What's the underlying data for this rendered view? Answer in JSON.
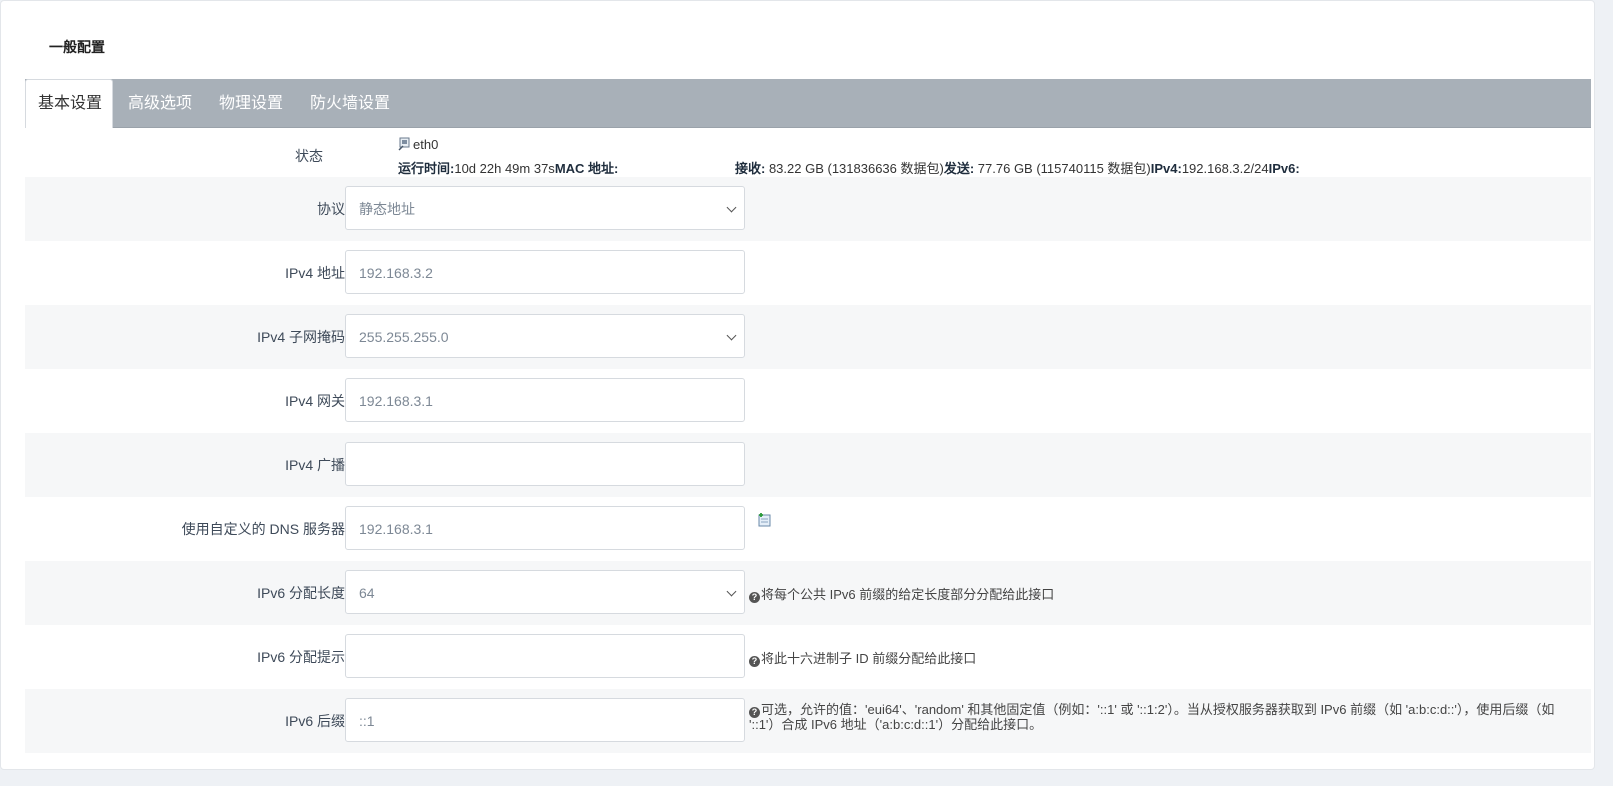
{
  "section_title": "一般配置",
  "tabs": [
    {
      "label": "基本设置",
      "active": true
    },
    {
      "label": "高级选项",
      "active": false
    },
    {
      "label": "物理设置",
      "active": false
    },
    {
      "label": "防火墙设置",
      "active": false
    }
  ],
  "status": {
    "label": "状态",
    "interface": "eth0",
    "uptime_label": "运行时间:",
    "uptime_value": "10d 22h 49m 37s",
    "mac_label": "MAC 地址:",
    "rx_label": "接收:",
    "rx_value": " 83.22 GB (131836636 数据包)",
    "tx_label": "发送:",
    "tx_value": " 77.76 GB (115740115 数据包)",
    "ipv4_label": "IPv4:",
    "ipv4_value": "192.168.3.2/24",
    "ipv6_label": "IPv6:"
  },
  "form": {
    "protocol": {
      "label": "协议",
      "value": "静态地址"
    },
    "ipv4_addr": {
      "label": "IPv4 地址",
      "value": "192.168.3.2"
    },
    "ipv4_mask": {
      "label": "IPv4 子网掩码",
      "value": "255.255.255.0"
    },
    "ipv4_gw": {
      "label": "IPv4 网关",
      "value": "192.168.3.1"
    },
    "ipv4_bcast": {
      "label": "IPv4 广播",
      "value": ""
    },
    "dns": {
      "label": "使用自定义的 DNS 服务器",
      "value": "192.168.3.1"
    },
    "ip6_assign": {
      "label": "IPv6 分配长度",
      "value": "64",
      "hint": "将每个公共 IPv6 前缀的给定长度部分分配给此接口"
    },
    "ip6_hint": {
      "label": "IPv6 分配提示",
      "value": "",
      "hint": "将此十六进制子 ID 前缀分配给此接口"
    },
    "ip6_suffix": {
      "label": "IPv6 后缀",
      "value": "::1",
      "hint": "可选，允许的值：'eui64'、'random' 和其他固定值（例如：'::1' 或 '::1:2'）。当从授权服务器获取到 IPv6 前缀（如 'a:b:c:d::'），使用后缀（如 '::1'）合成 IPv6 地址（'a:b:c:d::1'）分配给此接口。"
    }
  },
  "icons": {
    "help": "?",
    "interface": "ethernet-port-icon",
    "add": "add-entry-icon"
  }
}
